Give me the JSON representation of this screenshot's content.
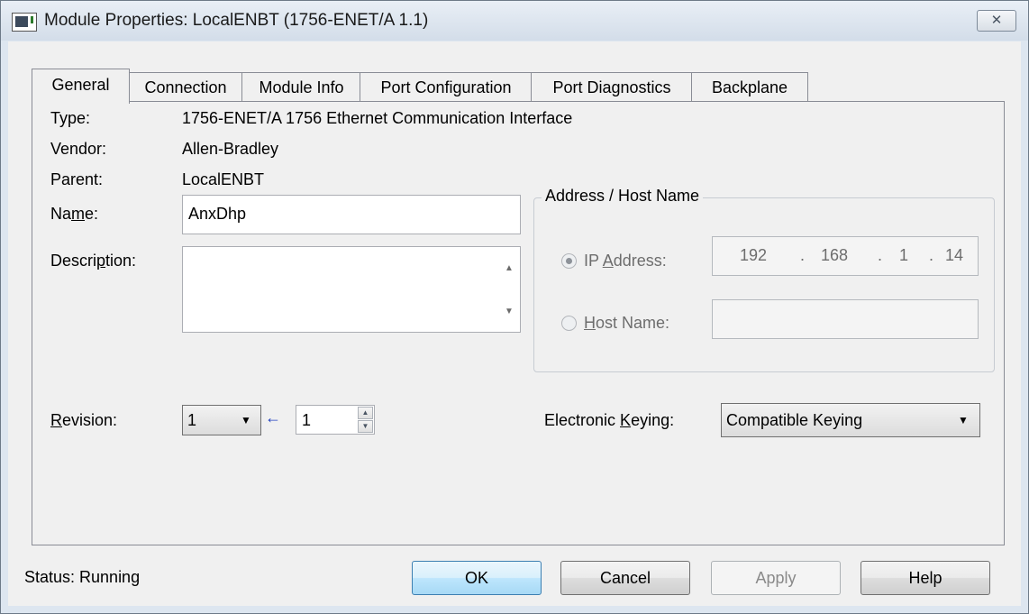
{
  "window": {
    "title": "Module Properties: LocalENBT (1756-ENET/A 1.1)",
    "close_glyph": "✕"
  },
  "tabs": [
    {
      "label": "General",
      "active": true
    },
    {
      "label": "Connection",
      "active": false
    },
    {
      "label": "Module Info",
      "active": false
    },
    {
      "label": "Port Configuration",
      "active": false
    },
    {
      "label": "Port Diagnostics",
      "active": false
    },
    {
      "label": "Backplane",
      "active": false
    }
  ],
  "general": {
    "type_label": "Type:",
    "type_value": "1756-ENET/A 1756 Ethernet Communication Interface",
    "vendor_label": "Vendor:",
    "vendor_value": "Allen-Bradley",
    "parent_label": "Parent:",
    "parent_value": "LocalENBT",
    "name_label_pre": "Na",
    "name_label_u": "m",
    "name_label_post": "e:",
    "name_value": "AnxDhp",
    "description_label_pre": "Descri",
    "description_label_u": "p",
    "description_label_post": "tion:",
    "description_value": "",
    "revision_label_u": "R",
    "revision_label_post": "evision:",
    "revision_major": "1",
    "revision_minor": "1",
    "keying_label_pre": "Electronic ",
    "keying_label_u": "K",
    "keying_label_post": "eying:",
    "keying_value": "Compatible Keying"
  },
  "address": {
    "group_title": "Address / Host Name",
    "ip_label_pre": "IP ",
    "ip_label_u": "A",
    "ip_label_post": "ddress:",
    "ip_octets": [
      "192",
      "168",
      "1",
      "14"
    ],
    "ip_dot": ".",
    "ip_selected": true,
    "host_label_u": "H",
    "host_label_post": "ost Name:",
    "host_value": ""
  },
  "buttons": {
    "ok": "OK",
    "cancel": "Cancel",
    "apply": "Apply",
    "help": "Help"
  },
  "status": {
    "text": "Status:  Running"
  },
  "icons": {
    "revision_arrow": "←",
    "dropdown": "▼"
  },
  "colors": {
    "arrow_blue": "#1f3fbf",
    "primary_border": "#3c7fb1"
  }
}
